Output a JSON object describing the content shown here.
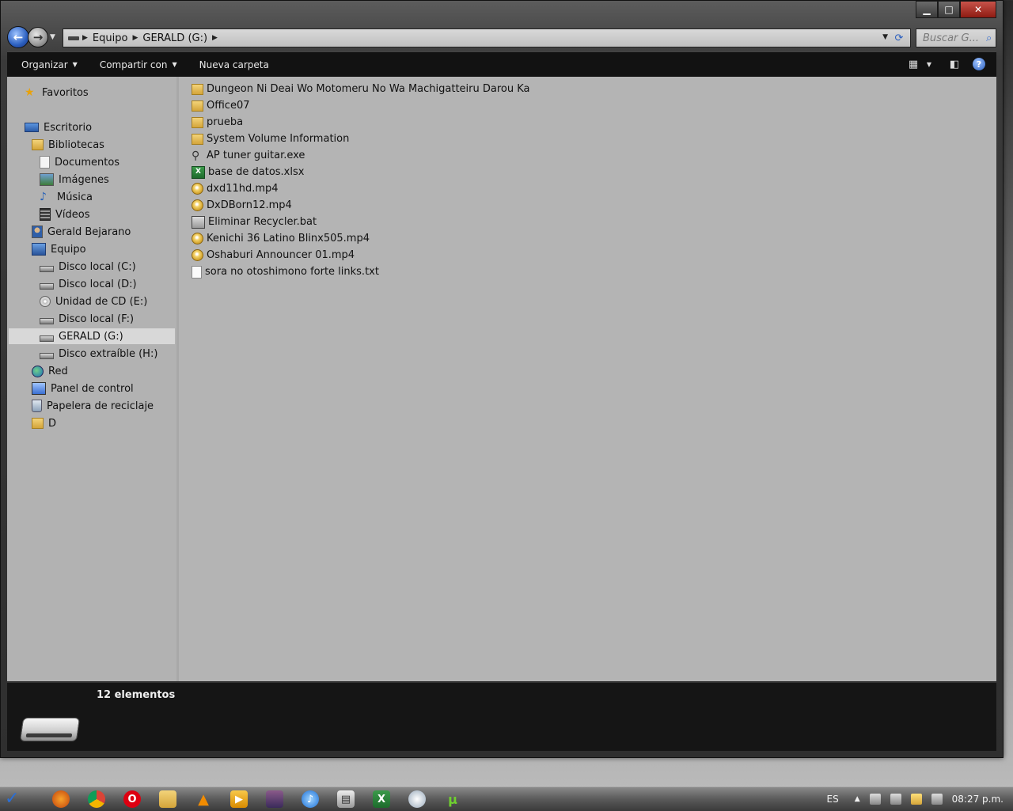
{
  "window": {
    "caption": {
      "minimize": "▁",
      "maximize": "□",
      "close": "✕"
    }
  },
  "nav": {
    "back_icon": "back-arrow-icon",
    "forward_icon": "forward-arrow-icon",
    "breadcrumbs": [
      "Equipo",
      "GERALD (G:)"
    ],
    "search_placeholder": "Buscar G..."
  },
  "toolbar": {
    "organize": "Organizar",
    "share": "Compartir con",
    "new_folder": "Nueva carpeta"
  },
  "sidebar": {
    "items": [
      {
        "label": "Favoritos",
        "icon": "star-icon",
        "indent": 0
      },
      {
        "label": "Escritorio",
        "icon": "desktop-icon",
        "indent": 0
      },
      {
        "label": "Bibliotecas",
        "icon": "libraries-icon",
        "indent": 1
      },
      {
        "label": "Documentos",
        "icon": "documents-icon",
        "indent": 2
      },
      {
        "label": "Imágenes",
        "icon": "pictures-icon",
        "indent": 2
      },
      {
        "label": "Música",
        "icon": "music-icon",
        "indent": 2
      },
      {
        "label": "Vídeos",
        "icon": "videos-icon",
        "indent": 2
      },
      {
        "label": "Gerald Bejarano",
        "icon": "user-folder-icon",
        "indent": 1
      },
      {
        "label": "Equipo",
        "icon": "computer-icon",
        "indent": 1
      },
      {
        "label": "Disco local (C:)",
        "icon": "drive-icon",
        "indent": 2
      },
      {
        "label": "Disco local (D:)",
        "icon": "drive-icon",
        "indent": 2
      },
      {
        "label": "Unidad de CD (E:)",
        "icon": "cd-drive-icon",
        "indent": 2
      },
      {
        "label": "Disco local (F:)",
        "icon": "drive-icon",
        "indent": 2
      },
      {
        "label": "GERALD (G:)",
        "icon": "removable-drive-icon",
        "indent": 2,
        "selected": true
      },
      {
        "label": "Disco extraíble (H:)",
        "icon": "removable-drive-icon",
        "indent": 2
      },
      {
        "label": "Red",
        "icon": "network-icon",
        "indent": 1
      },
      {
        "label": "Panel de control",
        "icon": "control-panel-icon",
        "indent": 1
      },
      {
        "label": "Papelera de reciclaje",
        "icon": "recycle-bin-icon",
        "indent": 1
      },
      {
        "label": "D",
        "icon": "folder-icon",
        "indent": 1
      }
    ]
  },
  "files": [
    {
      "name": "Dungeon Ni Deai Wo Motomeru No Wa Machigatteiru Darou Ka",
      "icon": "folder-icon"
    },
    {
      "name": "Office07",
      "icon": "folder-icon"
    },
    {
      "name": "prueba",
      "icon": "folder-icon"
    },
    {
      "name": "System Volume Information",
      "icon": "folder-icon"
    },
    {
      "name": "AP tuner guitar.exe",
      "icon": "guitar-exe-icon"
    },
    {
      "name": "base de datos.xlsx",
      "icon": "excel-icon"
    },
    {
      "name": "dxd11hd.mp4",
      "icon": "video-file-icon"
    },
    {
      "name": "DxDBorn12.mp4",
      "icon": "video-file-icon"
    },
    {
      "name": "Eliminar Recycler.bat",
      "icon": "batch-file-icon"
    },
    {
      "name": "Kenichi 36 Latino Blinx505.mp4",
      "icon": "video-file-icon"
    },
    {
      "name": "Oshaburi Announcer 01.mp4",
      "icon": "video-file-icon"
    },
    {
      "name": "sora no otoshimono forte links.txt",
      "icon": "text-file-icon"
    }
  ],
  "details": {
    "item_count": "12 elementos"
  },
  "taskbar": {
    "apps": [
      "firefox",
      "chrome",
      "opera",
      "explorer",
      "vlc",
      "media-player",
      "winrar",
      "itunes",
      "calculator",
      "excel",
      "paint",
      "utorrent"
    ],
    "language": "ES",
    "time": "08:27 p.m."
  }
}
